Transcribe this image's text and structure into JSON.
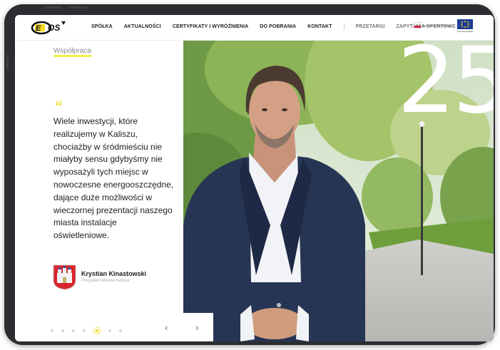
{
  "header": {
    "nav": [
      {
        "label": "SPÓŁKA"
      },
      {
        "label": "AKTUALNOŚCI"
      },
      {
        "label": "CERTYFIKATY I WYRÓŻNIENIA"
      },
      {
        "label": "DO POBRANIA"
      },
      {
        "label": "KONTAKT"
      }
    ],
    "nav_secondary": [
      {
        "label": "PRZETARGI"
      },
      {
        "label": "ZAPYTANIA OFERTOWE"
      }
    ],
    "bip_text": "Biuletyn Informacji Publicznej",
    "eu_text": "Unia Europejska"
  },
  "main": {
    "section_link": "Współpraca",
    "quote_mark": "“",
    "quote": "Wiele inwestycji, które realizujemy w Kaliszu, chociażby w śródmieściu nie miałyby sensu gdybyśmy nie wyposażyli tych miejsc w nowoczesne energooszczędne, dające duże możliwości w wieczornej prezentacji naszego miasta instalacje oświetleniowe.",
    "author_name": "Krystian Kinastowski",
    "author_role": "Prezydent Miasta Kalisza",
    "big_number": "25"
  },
  "pager": {
    "count": 7,
    "active_index": 4,
    "prev": "‹",
    "next": "›"
  },
  "colors": {
    "accent_yellow": "#f1dd32",
    "frame": "#2b2d31",
    "eu_blue": "#1f3f95"
  },
  "icons": [
    "eos-logo",
    "bip-flag-icon",
    "eu-flag-icon",
    "crest-icon",
    "chevron-left-icon",
    "chevron-right-icon"
  ]
}
